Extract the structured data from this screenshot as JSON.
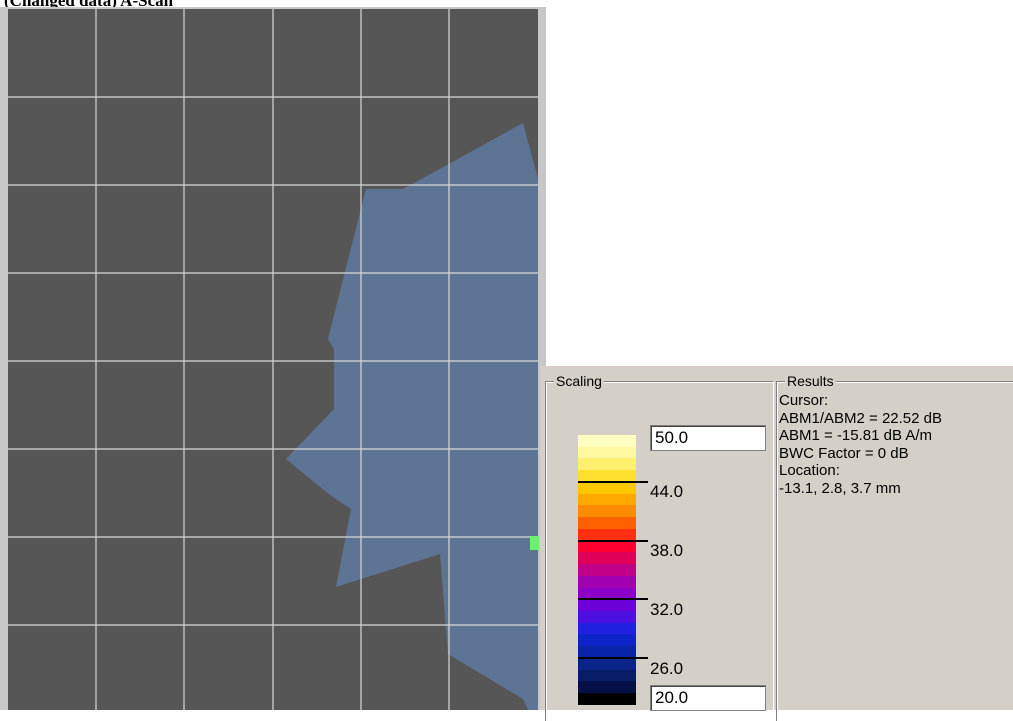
{
  "header": {
    "caption": "(Changed data) A-Scan"
  },
  "scaling": {
    "title": "Scaling",
    "max_value": "50.0",
    "min_value": "20.0",
    "ticks": [
      "44.0",
      "38.0",
      "32.0",
      "26.0"
    ],
    "bands": [
      "#ffffc0",
      "#fff8a0",
      "#fff070",
      "#ffe030",
      "#ffc800",
      "#ffa800",
      "#ff8c00",
      "#ff6000",
      "#ff3010",
      "#ff0030",
      "#e00058",
      "#c00088",
      "#a000b0",
      "#8c00c8",
      "#6c00d8",
      "#4c10e0",
      "#2020e0",
      "#0c24c8",
      "#0824a8",
      "#082488",
      "#061c66",
      "#051048",
      "#000000"
    ],
    "band_separators_after": [
      4,
      9,
      14,
      19
    ]
  },
  "results": {
    "title": "Results",
    "lines": [
      "Cursor:",
      "ABM1/ABM2 = 22.52 dB",
      "ABM1 = -15.81 dB A/m",
      "BWC Factor = 0 dB",
      "Location:",
      "-13.1, 2.8, 3.7 mm"
    ]
  },
  "plot": {
    "background_color": "#565656",
    "grid_color": "#d8d8d8",
    "region_color": "#5e7494",
    "marker_color": "#6fef6f"
  }
}
